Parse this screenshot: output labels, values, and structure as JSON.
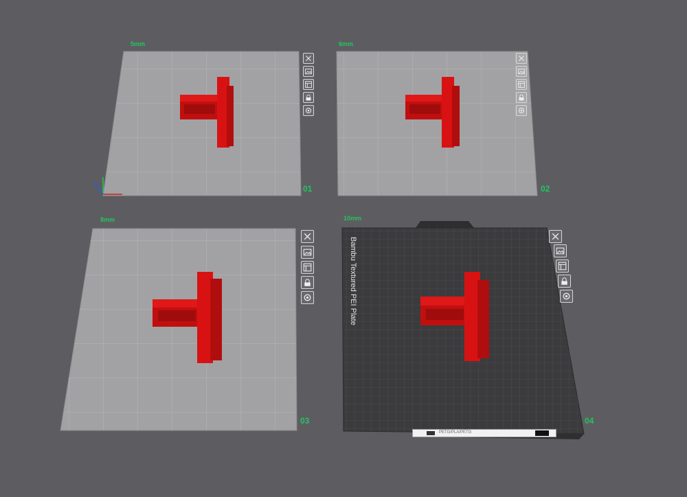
{
  "plates": [
    {
      "id": "plate-1",
      "label": "5mm",
      "number": "01"
    },
    {
      "id": "plate-2",
      "label": "6mm",
      "number": "02"
    },
    {
      "id": "plate-3",
      "label": "8mm",
      "number": "03"
    },
    {
      "id": "plate-4",
      "label": "10mm",
      "number": "04"
    }
  ],
  "plate4_name": "Bambu Textured PEI Plate",
  "plate4_label_strip": "PETG/PLA/PETG",
  "colors": {
    "background": "#5d5d61",
    "light_plate": "#a2a2a4",
    "dark_plate": "#3b3b3d",
    "model": "#d01010",
    "accent_green": "#22c55e"
  },
  "tool_icons": [
    "close-icon",
    "image-icon",
    "layout-icon",
    "lock-icon",
    "settings-icon"
  ]
}
